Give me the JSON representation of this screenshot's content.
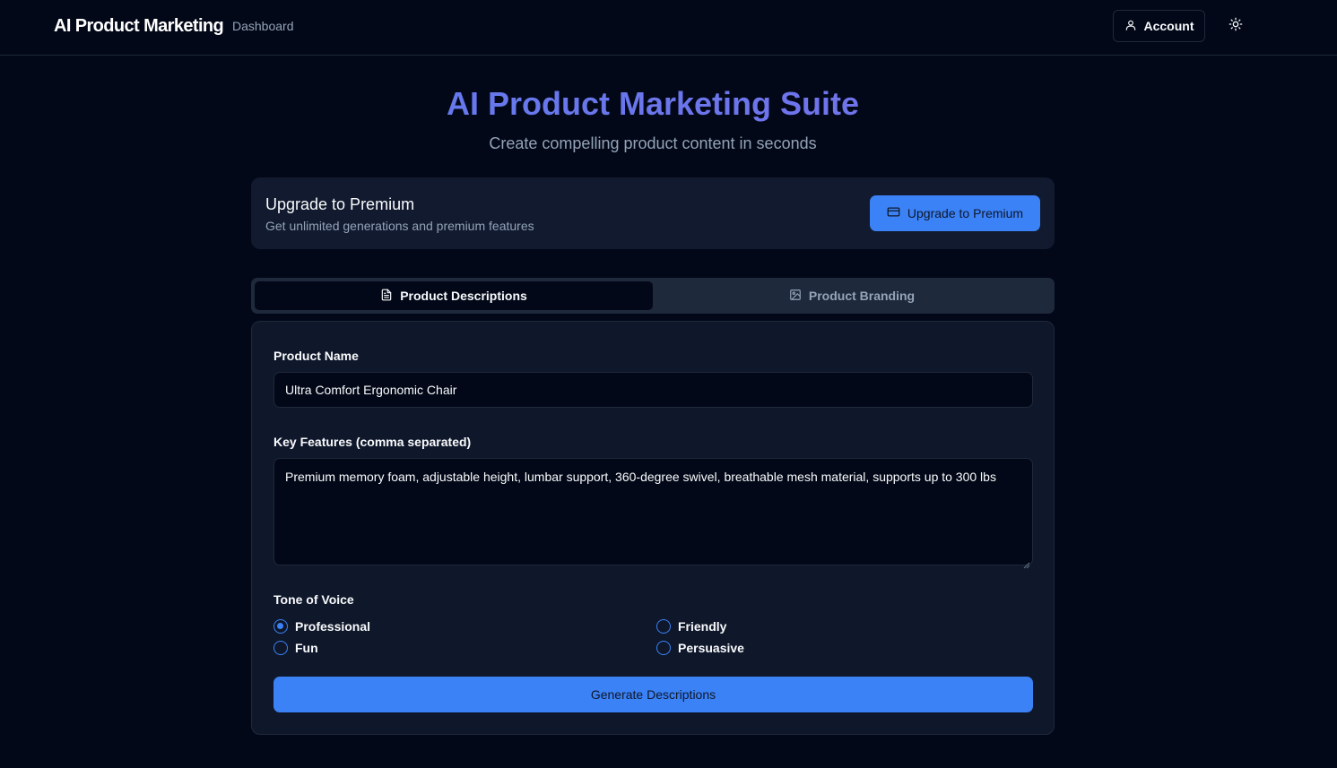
{
  "header": {
    "brand": "AI Product Marketing",
    "nav_dashboard": "Dashboard",
    "account_label": "Account",
    "account_icon": "user-icon",
    "theme_icon": "sun-icon"
  },
  "hero": {
    "title": "AI Product Marketing Suite",
    "subtitle": "Create compelling product content in seconds"
  },
  "premium": {
    "title": "Upgrade to Premium",
    "description": "Get unlimited generations and premium features",
    "button_label": "Upgrade to Premium",
    "button_icon": "credit-card-icon"
  },
  "tabs": [
    {
      "label": "Product Descriptions",
      "icon": "file-text-icon",
      "active": true
    },
    {
      "label": "Product Branding",
      "icon": "image-icon",
      "active": false
    }
  ],
  "form": {
    "product_name_label": "Product Name",
    "product_name_value": "Ultra Comfort Ergonomic Chair",
    "features_label": "Key Features (comma separated)",
    "features_value": "Premium memory foam, adjustable height, lumbar support, 360-degree swivel, breathable mesh material, supports up to 300 lbs",
    "tone_label": "Tone of Voice",
    "tones": [
      {
        "label": "Professional",
        "checked": true
      },
      {
        "label": "Friendly",
        "checked": false
      },
      {
        "label": "Fun",
        "checked": false
      },
      {
        "label": "Persuasive",
        "checked": false
      }
    ],
    "generate_label": "Generate Descriptions"
  },
  "colors": {
    "background": "#020817",
    "accent": "#3b82f6",
    "card": "#111a2e",
    "border": "#1e293b",
    "muted_text": "#94a3b8"
  }
}
